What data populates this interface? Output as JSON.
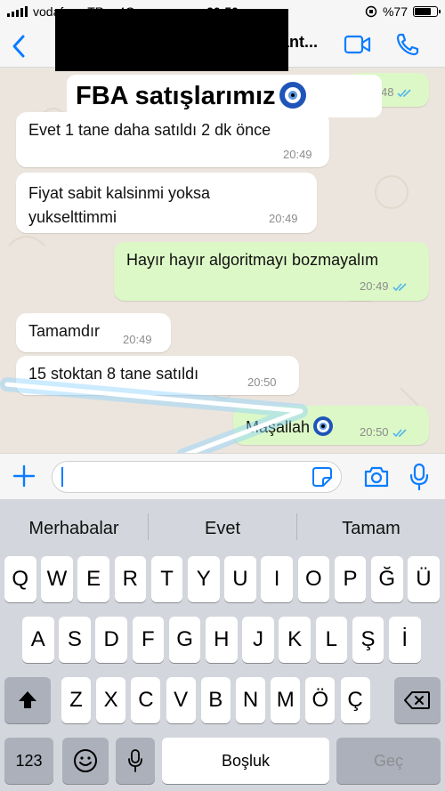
{
  "status_bar": {
    "carrier": "vodafone TR",
    "network": "4G",
    "time": "20:50",
    "battery": "%77",
    "battery_level": 0.77
  },
  "header": {
    "contact_name_visible": "iant..."
  },
  "overlay_caption": {
    "title": "FBA satışlarımız"
  },
  "messages": [
    {
      "dir": "out",
      "text": "",
      "time": "48"
    },
    {
      "dir": "in",
      "text": "Evet 1 tane daha satıldı 2 dk önce",
      "time": "20:49"
    },
    {
      "dir": "in",
      "line1": "Fiyat sabit kalsinmi yoksa",
      "line2": "yukselttimmi",
      "time": "20:49"
    },
    {
      "dir": "out",
      "text": "Hayır hayır algoritmayı bozmayalım",
      "time": "20:49"
    },
    {
      "dir": "in",
      "text": "Tamamdır",
      "time": "20:49"
    },
    {
      "dir": "in",
      "text": "15 stoktan 8 tane satıldı",
      "time": "20:50"
    },
    {
      "dir": "out",
      "text": "Maşallah",
      "time": "20:50"
    }
  ],
  "composer": {
    "value": "",
    "placeholder": ""
  },
  "keyboard": {
    "suggestions": [
      "Merhabalar",
      "Evet",
      "Tamam"
    ],
    "row1": [
      "Q",
      "W",
      "E",
      "R",
      "T",
      "Y",
      "U",
      "I",
      "O",
      "P",
      "Ğ",
      "Ü"
    ],
    "row2": [
      "A",
      "S",
      "D",
      "F",
      "G",
      "H",
      "J",
      "K",
      "L",
      "Ş",
      "İ"
    ],
    "row3": [
      "Z",
      "X",
      "C",
      "V",
      "B",
      "N",
      "M",
      "Ö",
      "Ç"
    ],
    "numbers_label": "123",
    "space_label": "Boşluk",
    "return_label": "Geç"
  },
  "colors": {
    "ios_blue": "#0A7CFF",
    "chat_bg": "#ECE5DD",
    "bubble_out": "#DCF8C6",
    "bubble_in": "#FFFFFF",
    "read_ticks": "#4FB6EC"
  }
}
